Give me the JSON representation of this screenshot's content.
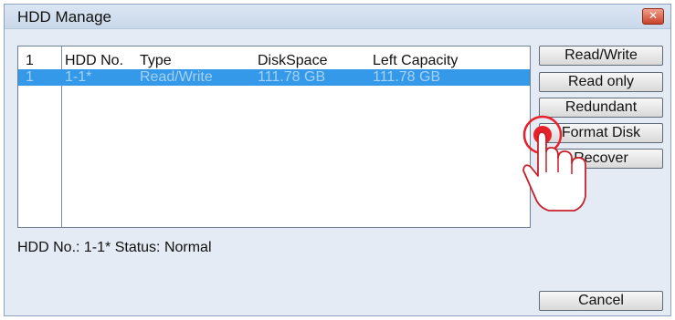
{
  "window": {
    "title": "HDD Manage",
    "close_glyph": "✕"
  },
  "table": {
    "headers": {
      "index": "1",
      "hdd_no": "HDD No.",
      "type": "Type",
      "disk_space": "DiskSpace",
      "left_capacity": "Left Capacity"
    },
    "rows": [
      {
        "index": "1",
        "hdd_no": "1-1*",
        "type": "Read/Write",
        "disk_space": "111.78 GB",
        "left_capacity": "111.78 GB"
      }
    ]
  },
  "status_text": "HDD No.: 1-1* Status: Normal",
  "buttons": {
    "read_write": "Read/Write",
    "read_only": "Read only",
    "redundant": "Redundant",
    "format_disk": "Format Disk",
    "recover": "Recover",
    "cancel": "Cancel"
  },
  "colors": {
    "selection": "#3399e8",
    "pointer_highlight": "#e8202a"
  },
  "pointer": {
    "icon": "pointing-hand-icon",
    "target": "format_disk"
  }
}
